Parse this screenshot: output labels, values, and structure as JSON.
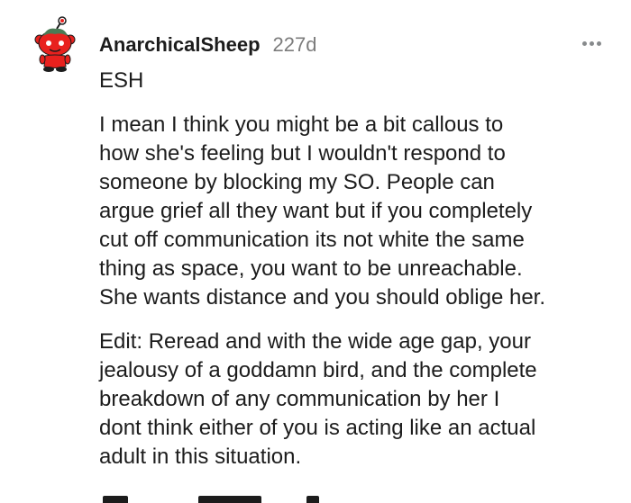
{
  "comment": {
    "author": "AnarchicalSheep",
    "age": "227d",
    "paragraphs": [
      "ESH",
      "I mean I think you might be a bit callous to\nhow she's feeling but I wouldn't respond to\nsomeone by blocking my SO. People can\nargue grief all they want but if you completely\ncut off communication its not white the same\nthing as space, you want to be unreachable.\nShe wants distance and you should oblige her.",
      "Edit: Reread and with the wide age gap, your\njealousy of a goddamn bird, and the complete\nbreakdown of any communication by her I\ndont think either of you is acting like an actual\nadult in this situation."
    ]
  },
  "icons": {
    "avatar": "snoo-avatar-icon",
    "more": "more-options-icon"
  },
  "colors": {
    "avatar_red": "#e8211e",
    "text": "#1c1c1c",
    "meta": "#7c7c7c"
  }
}
